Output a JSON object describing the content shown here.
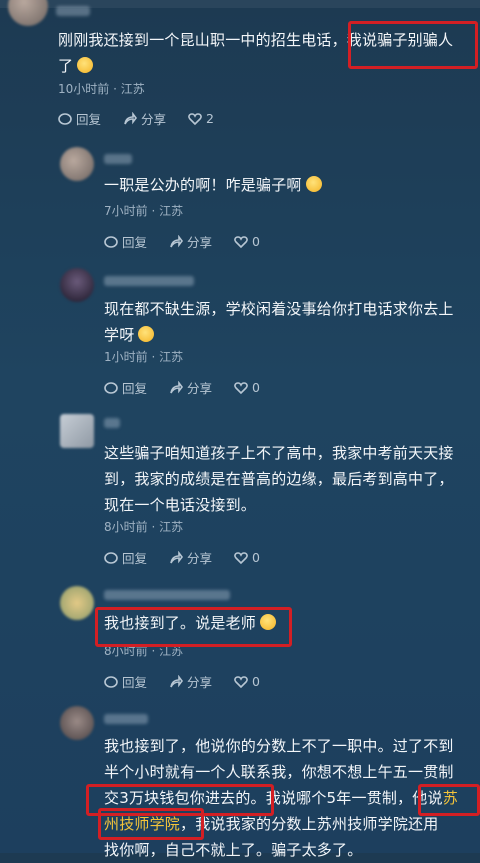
{
  "comments": [
    {
      "text_line1": "刚刚我还接到一个昆山职一中的招生电话，我说骗子别骗人",
      "text_line2": "了",
      "time": "10小时前",
      "location": "江苏",
      "reply_label": "回复",
      "share_label": "分享",
      "likes": "2"
    },
    {
      "text_line1": "一职是公办的啊！咋是骗子啊",
      "time": "7小时前",
      "location": "江苏",
      "reply_label": "回复",
      "share_label": "分享",
      "likes": "0"
    },
    {
      "text_line1": "现在都不缺生源，学校闲着没事给你打电话求你去上",
      "text_line2": "学呀",
      "time": "1小时前",
      "location": "江苏",
      "reply_label": "回复",
      "share_label": "分享",
      "likes": "0"
    },
    {
      "text_line1": "这些骗子咱知道孩子上不了高中，我家中考前天天接",
      "text_line2": "到，我家的成绩是在普高的边缘，最后考到高中了，",
      "text_line3": "现在一个电话没接到。",
      "time": "8小时前",
      "location": "江苏",
      "reply_label": "回复",
      "share_label": "分享",
      "likes": "0"
    },
    {
      "text_line1": "我也接到了。说是老师",
      "time": "8小时前",
      "location": "江苏",
      "reply_label": "回复",
      "share_label": "分享",
      "likes": "0"
    },
    {
      "text_line1": "我也接到了，他说你的分数上不了一职中。过了不到",
      "text_line2": "半个小时就有一个人联系我，你想不想上午五一贯制",
      "text_line3a": "交3万块钱包你进去的",
      "text_line3b": "。我说哪个5年一贯制，",
      "text_line3c": "他说",
      "text_line3d": "苏",
      "text_line4a": "州技师学院",
      "text_line4b": "，我说我家的分数上苏州技师学院还用",
      "text_line5": "找你啊，自己不就上了。骗子太多了。"
    }
  ]
}
